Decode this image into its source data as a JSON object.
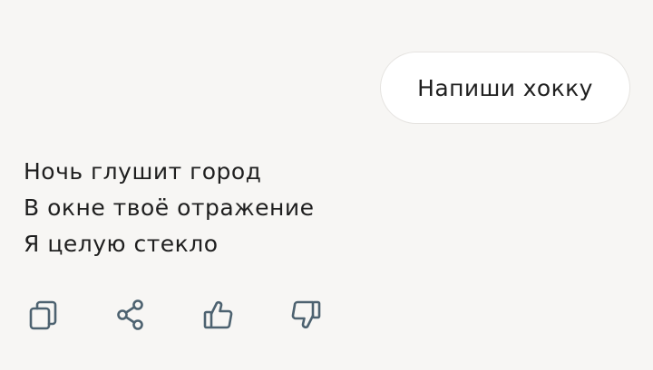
{
  "conversation": {
    "user_message": "Напиши хокку",
    "assistant_message": {
      "lines": [
        "Ночь глушит город",
        "В окне твоё отражение",
        "Я целую стекло"
      ]
    }
  },
  "actions": [
    {
      "name": "copy",
      "icon": "copy-icon"
    },
    {
      "name": "share",
      "icon": "share-icon"
    },
    {
      "name": "like",
      "icon": "thumbs-up-icon"
    },
    {
      "name": "dislike",
      "icon": "thumbs-down-icon"
    }
  ],
  "colors": {
    "background": "#f7f6f4",
    "bubble": "#ffffff",
    "text": "#1f1f1f",
    "icon": "#4d6270"
  }
}
